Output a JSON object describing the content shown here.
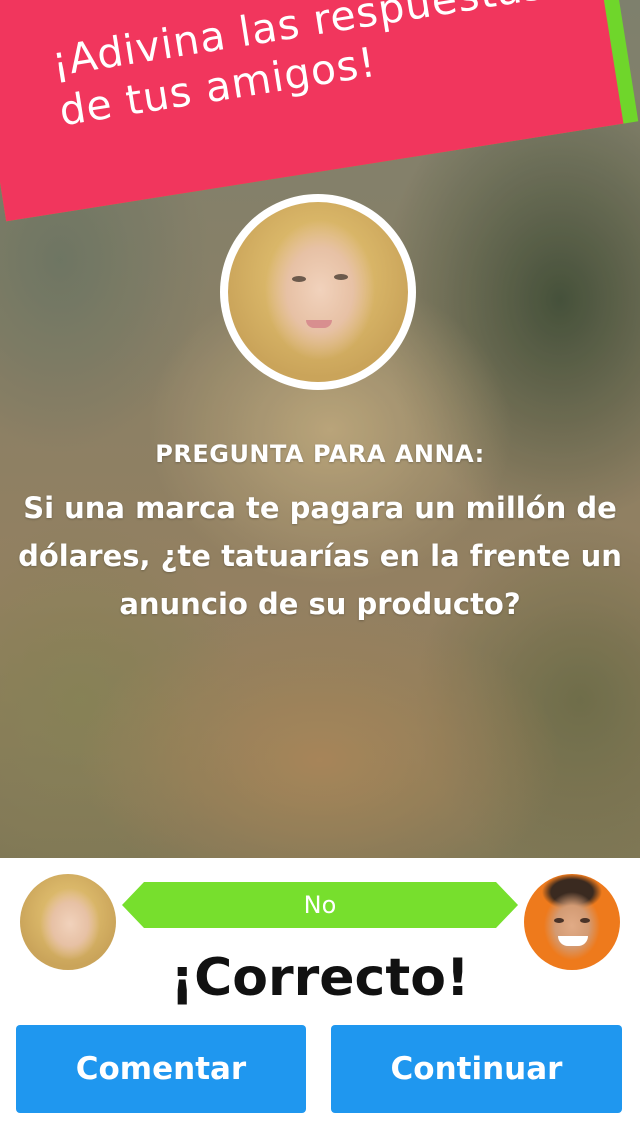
{
  "banner": {
    "text": "¡Adivina las respuestas de tus amigos!",
    "color_pink": "#f1365d",
    "color_green": "#6fd62b"
  },
  "question": {
    "label": "PREGUNTA PARA ANNA:",
    "text": "Si una marca te pagara un millón de dólares, ¿te tatuarías en la frente un anuncio de su producto?"
  },
  "answer": {
    "value": "No",
    "color": "#77df2d"
  },
  "result": {
    "text": "¡Correcto!"
  },
  "buttons": {
    "comment_label": "Comentar",
    "continue_label": "Continuar",
    "color": "#1f97ef"
  }
}
